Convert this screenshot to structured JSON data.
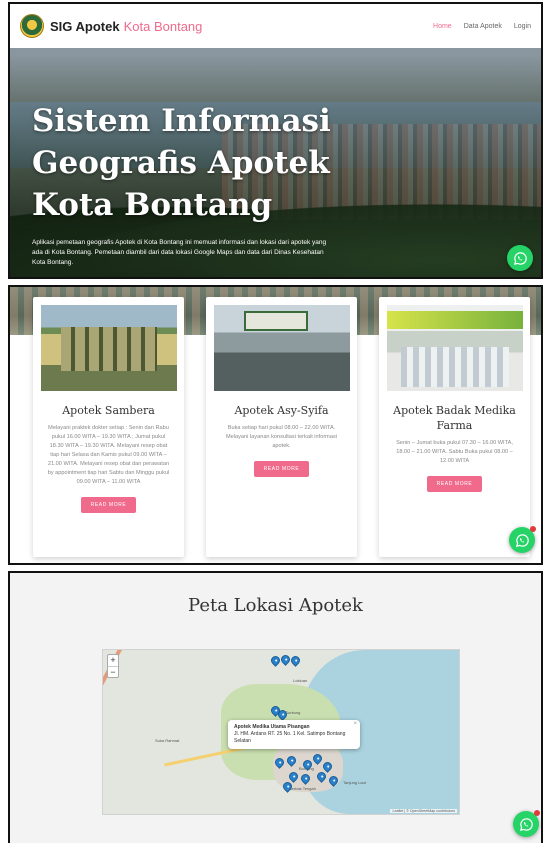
{
  "navbar": {
    "brand": "SIG Apotek",
    "brand_accent": "Kota Bontang",
    "links": [
      "Home",
      "Data Apotek",
      "Login"
    ]
  },
  "hero": {
    "title": "Sistem Informasi Geografis Apotek Kota Bontang",
    "description": "Aplikasi pemetaan geografis Apotek di Kota Bontang ini memuat informasi dan lokasi dari apotek yang ada di Kota Bontang. Pemetaan diambil dari data lokasi Google Maps dan data dari Dinas Kesehatan Kota Bontang."
  },
  "cards": [
    {
      "title": "Apotek Sambera",
      "description": "Melayani praktek dokter setiap : Senin dan Rabu pukul 16.00 WITA – 19.30 WITA ; Jumat pukul 18.30 WITA – 19.30 WITA. Melayani resep obat tiap hari Selasa dan Kamis pukul 09.00 WITA – 21.00 WITA. Melayani resep obat dan perawatan by appointment tiap hari Sabtu dan Minggu pukul 09.00 WITA – 11.00 WITA",
      "button": "READ MORE"
    },
    {
      "title": "Apotek Asy-Syifa",
      "description": "Buka setiap hari pukul 08.00 – 22.00 WITA. Melayani layanan konsultasi terkait informasi apotek.",
      "button": "READ MORE"
    },
    {
      "title": "Apotek Badak Medika Farma",
      "description": "Senin – Jumat buka pukul 07.30 – 16.00 WITA, 18.00 – 21.00 WITA. Sabtu Buka pukul 08.00 – 12.00 WITA",
      "button": "READ MORE"
    }
  ],
  "map_section": {
    "title": "Peta Lokasi Apotek",
    "zoom_in": "+",
    "zoom_out": "−",
    "popup": {
      "name": "Apotek Medika Utama Pisangan",
      "address": "Jl. HM. Ardans RT. 25 No. 1 Kel. Satimpo Bontang Selatan",
      "close": "×"
    },
    "labels": [
      "Loktuan",
      "Guntung",
      "Suka Rahmat",
      "Bontang",
      "Berbas Tengah",
      "Tanjung Laut"
    ],
    "attribution": "Leaflet | © OpenStreetMap contributors"
  },
  "colors": {
    "accent": "#f06a8c",
    "whatsapp": "#25d366",
    "marker": "#2a81cb"
  }
}
